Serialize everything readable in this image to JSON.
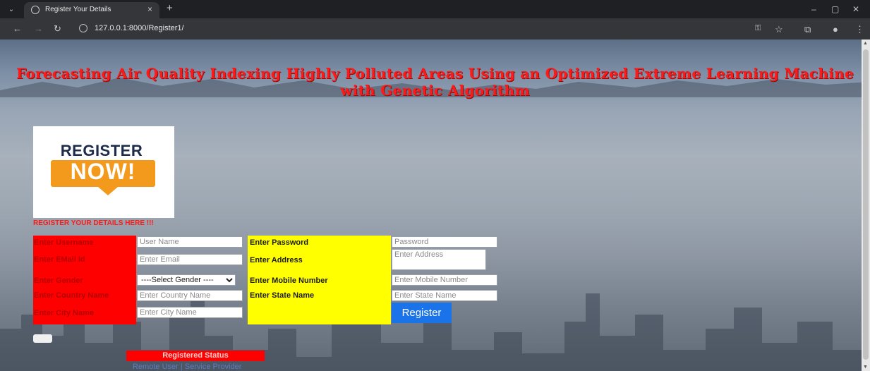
{
  "browser": {
    "tab_title": "Register Your Details",
    "tab_close": "×",
    "new_tab": "+",
    "address": "127.0.0.1:8000/Register1/",
    "controls": {
      "minimize": "–",
      "restore": "▢",
      "close": "✕"
    }
  },
  "page": {
    "title": "Forecasting Air Quality Indexing Highly Polluted Areas Using an Optimized Extreme Learning Machine with Genetic Algorithm",
    "logo": {
      "line1": "REGISTER",
      "line2": "NOW!"
    },
    "subtitle": "REGISTER YOUR DETAILS HERE !!!",
    "form": {
      "username_label": "Enter Username",
      "username_placeholder": "User Name",
      "email_label": "Enter EMail Id",
      "email_placeholder": "Enter Email",
      "gender_label": "Enter Gender",
      "gender_selected": "----Select Gender ----",
      "country_label": "Enter Country Name",
      "country_placeholder": "Enter Country Name",
      "city_label": "Enter City Name",
      "city_placeholder": "Enter City Name",
      "password_label": "Enter Password",
      "password_placeholder": "Password",
      "address_label": "Enter Address",
      "address_placeholder": "Enter Address",
      "mobile_label": "Enter Mobile Number",
      "mobile_placeholder": "Enter Mobile Number",
      "state_label": "Enter State Name",
      "state_placeholder": "Enter State Name",
      "register_button": "Register"
    },
    "status": {
      "label": "Registered Status",
      "links": "Remote User | Service Provider"
    }
  },
  "colors": {
    "title": "#ff1a1a",
    "left_column": "#ff0000",
    "right_column": "#ffff00",
    "button": "#1a73e8"
  }
}
